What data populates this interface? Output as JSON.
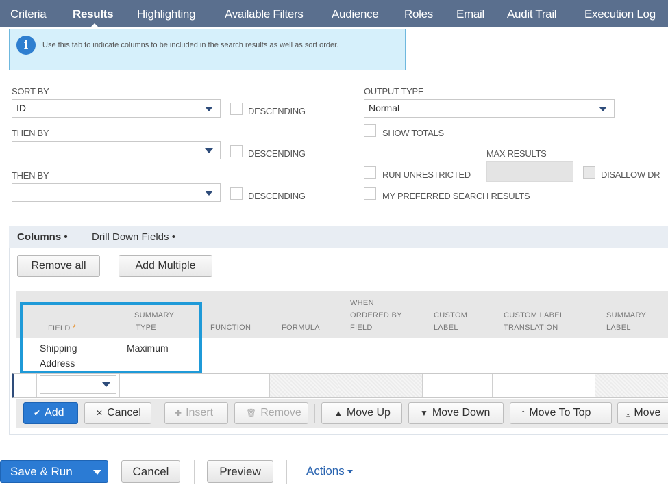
{
  "tabs": [
    {
      "label": "Criteria"
    },
    {
      "label": "Results"
    },
    {
      "label": "Highlighting"
    },
    {
      "label": "Available Filters"
    },
    {
      "label": "Audience"
    },
    {
      "label": "Roles"
    },
    {
      "label": "Email"
    },
    {
      "label": "Audit Trail"
    },
    {
      "label": "Execution Log"
    }
  ],
  "info": {
    "icon": "info-icon",
    "text": "Use this tab to indicate columns to be included in the search results as well as sort order."
  },
  "sort": {
    "sort_by_label": "SORT BY",
    "sort_by_value": "ID",
    "then_by_label_1": "THEN BY",
    "then_by_value_1": "",
    "then_by_label_2": "THEN BY",
    "then_by_value_2": "",
    "descending_label": "DESCENDING"
  },
  "output": {
    "output_type_label": "OUTPUT TYPE",
    "output_type_value": "Normal",
    "show_totals": "SHOW TOTALS",
    "max_results_label": "MAX RESULTS",
    "run_unrestricted": "RUN UNRESTRICTED",
    "disallow_drilldown": "DISALLOW DR",
    "preferred_results": "MY PREFERRED SEARCH RESULTS"
  },
  "subtabs": {
    "columns": "Columns",
    "drill_down": "Drill Down Fields"
  },
  "column_buttons": {
    "remove_all": "Remove all",
    "add_multiple": "Add Multiple"
  },
  "grid": {
    "headers": {
      "field": "FIELD",
      "summary_type_1": "SUMMARY",
      "summary_type_2": "TYPE",
      "function": "FUNCTION",
      "formula": "FORMULA",
      "when_ordered_1": "WHEN",
      "when_ordered_2": "ORDERED BY",
      "when_ordered_3": "FIELD",
      "custom_label_1": "CUSTOM",
      "custom_label_2": "LABEL",
      "custom_trans_1": "CUSTOM LABEL",
      "custom_trans_2": "TRANSLATION",
      "summary_label_1": "SUMMARY",
      "summary_label_2": "LABEL"
    },
    "rows": [
      {
        "field_1": "Shipping",
        "field_2": "Address",
        "summary_type": "Maximum"
      }
    ]
  },
  "row_actions": {
    "add": "Add",
    "cancel": "Cancel",
    "insert": "Insert",
    "remove": "Remove",
    "move_up": "Move Up",
    "move_down": "Move Down",
    "move_to_top": "Move To Top",
    "move_to_bottom": "Move"
  },
  "footer": {
    "save_run": "Save & Run",
    "cancel": "Cancel",
    "preview": "Preview",
    "actions": "Actions"
  },
  "colors": {
    "tabbar": "#5a6f8e",
    "primary_button": "#2b7bd4",
    "highlight_box": "#1f9ad8",
    "info_bg": "#d6f0fb"
  }
}
